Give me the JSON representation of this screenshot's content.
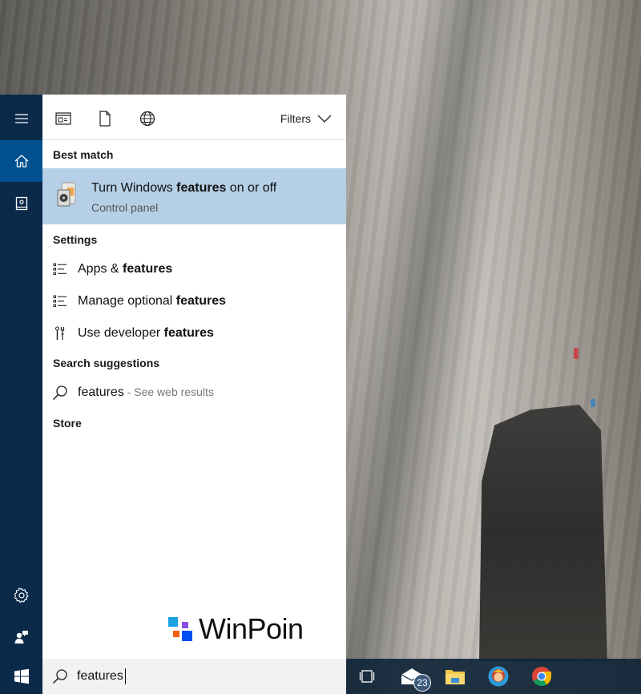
{
  "sidebar": {
    "items": [
      {
        "name": "menu",
        "icon": "hamburger-icon"
      },
      {
        "name": "home",
        "icon": "home-icon",
        "active": true
      },
      {
        "name": "notebook",
        "icon": "notebook-icon"
      },
      {
        "name": "settings",
        "icon": "gear-icon"
      },
      {
        "name": "feedback",
        "icon": "feedback-icon"
      }
    ]
  },
  "toolbar": {
    "icons": [
      "apps-icon",
      "document-icon",
      "web-icon"
    ],
    "filters_label": "Filters"
  },
  "results": {
    "best_match_header": "Best match",
    "best_match": {
      "title_pre": "Turn Windows ",
      "title_bold": "features",
      "title_post": " on or off",
      "subtitle": "Control panel"
    },
    "settings_header": "Settings",
    "settings": [
      {
        "pre": "Apps & ",
        "bold": "features",
        "icon": "list-icon"
      },
      {
        "pre": "Manage optional ",
        "bold": "features",
        "icon": "list-icon"
      },
      {
        "pre": "Use developer ",
        "bold": "features",
        "icon": "developer-tools-icon"
      }
    ],
    "suggestions_header": "Search suggestions",
    "suggestion": {
      "term": "features",
      "hint": " - See web results"
    },
    "store_header": "Store"
  },
  "watermark": {
    "text": "WinPoin",
    "colors": [
      "#1ba1e2",
      "#8b4ce6",
      "#f2600c",
      "#0050ef"
    ]
  },
  "search": {
    "value": "features",
    "placeholder": ""
  },
  "taskbar": {
    "apps": [
      {
        "name": "task-view",
        "icon": "task-view-icon"
      },
      {
        "name": "mail",
        "icon": "mail-icon",
        "badge": "23"
      },
      {
        "name": "file-explorer",
        "icon": "folder-icon"
      },
      {
        "name": "app-mascot",
        "icon": "mascot-icon"
      },
      {
        "name": "chrome",
        "icon": "chrome-icon"
      }
    ]
  },
  "colors": {
    "sidebar": "#0b2a4a",
    "sidebar_active": "#00508f",
    "highlight": "#b5cfe6"
  }
}
